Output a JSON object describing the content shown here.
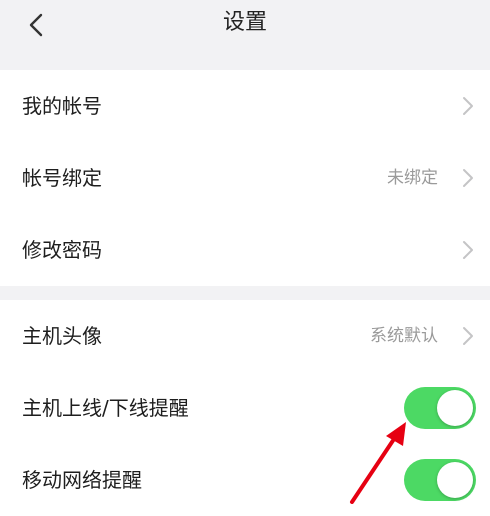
{
  "nav": {
    "title": "设置",
    "back_icon": "chevron-left-icon"
  },
  "group1": {
    "items": [
      {
        "label": "我的帐号",
        "value": "",
        "accessory": "chevron-right-icon"
      },
      {
        "label": "帐号绑定",
        "value": "未绑定",
        "accessory": "chevron-right-icon"
      },
      {
        "label": "修改密码",
        "value": "",
        "accessory": "chevron-right-icon"
      }
    ]
  },
  "group2": {
    "items": [
      {
        "label": "主机头像",
        "value": "系统默认",
        "accessory": "chevron-right-icon"
      },
      {
        "label": "主机上线/下线提醒",
        "toggle_on": true
      },
      {
        "label": "移动网络提醒",
        "toggle_on": true
      }
    ]
  },
  "colors": {
    "toggle_on": "#4cd964",
    "annotation_arrow": "#e60012",
    "background": "#f2f2f4"
  },
  "annotation": {
    "icon": "red-arrow-icon"
  }
}
